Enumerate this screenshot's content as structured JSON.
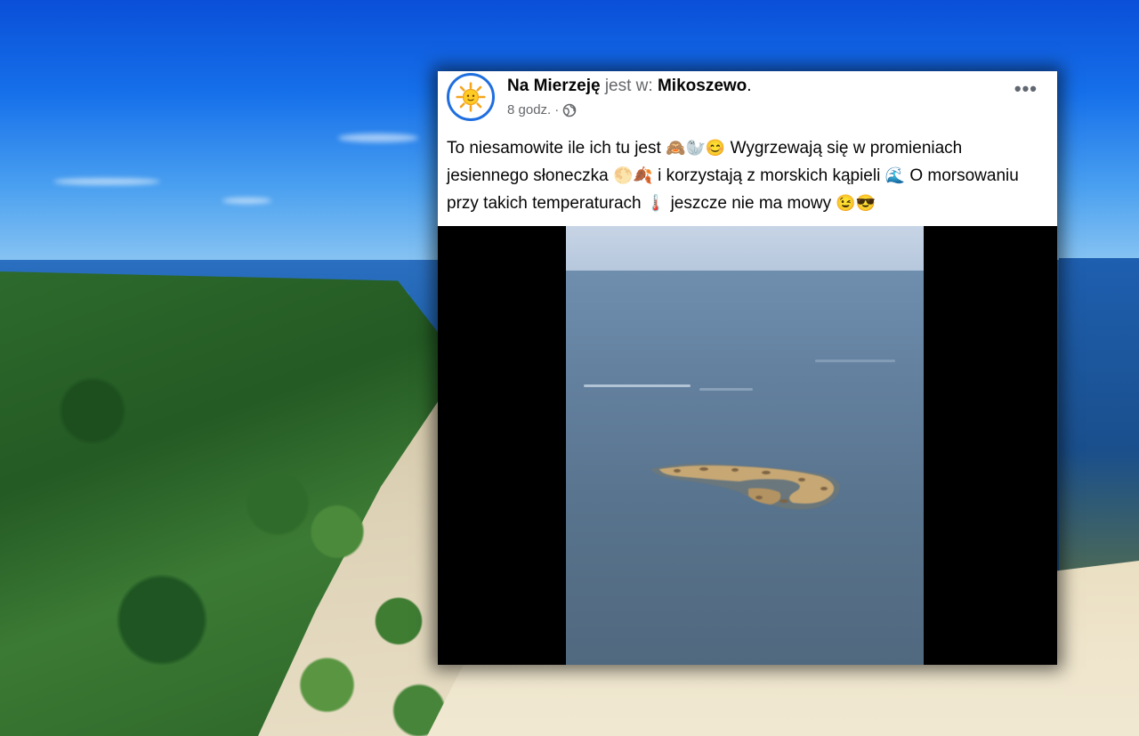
{
  "post": {
    "author": "Na Mierzeję",
    "is_at": "jest w:",
    "location": "Mikoszewo",
    "location_suffix": ".",
    "time": "8 godz.",
    "time_separator": "·",
    "more_label": "•••",
    "text_part1": "To niesamowite ile ich tu jest",
    "text_part1_emoji": "🙈🦭😊",
    "text_part2": "Wygrzewają się w promieniach jesiennego słoneczka",
    "text_part2_emoji": "🌕🍂",
    "text_part3": "i korzystają z morskich kąpieli",
    "text_part3_emoji": "🌊",
    "text_part4": "O morsowaniu przy takich temperaturach",
    "text_part4_emoji": "🌡️",
    "text_part5": "jeszcze nie ma mowy",
    "text_part5_emoji": "😉😎"
  },
  "icons": {
    "avatar": "sun-icon",
    "privacy": "globe-icon",
    "menu": "more-options-icon"
  },
  "colors": {
    "avatar_ring": "#1f6ee0",
    "text": "#050505",
    "muted": "#65676b"
  }
}
